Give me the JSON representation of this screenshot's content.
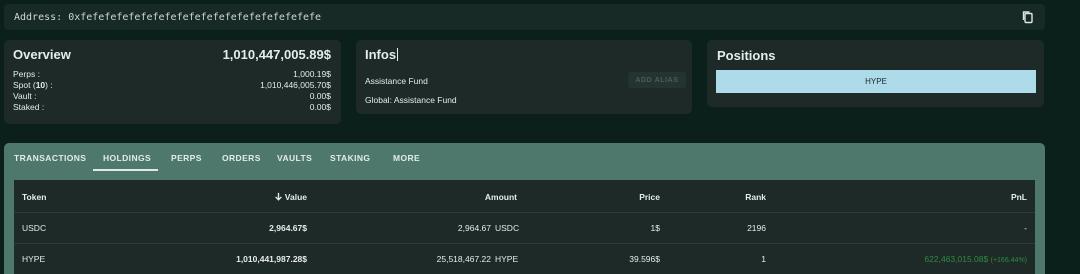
{
  "address": {
    "label": "Address:",
    "value": "0xfefefefefefefefefefefefefefefefefefefefe",
    "copy_icon": "copy-icon"
  },
  "overview": {
    "title": "Overview",
    "total": "1,010,447,005.89$",
    "rows": [
      {
        "label_prefix": "Perps :",
        "count": "",
        "label_suffix": "",
        "value": "1,000.19$"
      },
      {
        "label_prefix": "Spot (",
        "count": "10",
        "label_suffix": ") :",
        "value": "1,010,446,005.70$"
      },
      {
        "label_prefix": "Vault :",
        "count": "",
        "label_suffix": "",
        "value": "0.00$"
      },
      {
        "label_prefix": "Staked :",
        "count": "",
        "label_suffix": "",
        "value": "0.00$"
      }
    ]
  },
  "infos": {
    "title": "Infos",
    "line1": "Assistance Fund",
    "line2": "Global: Assistance Fund",
    "add_alias": "ADD ALIAS"
  },
  "positions": {
    "title": "Positions",
    "items": [
      "HYPE"
    ],
    "bar_color": "#aedbe9"
  },
  "tabs": {
    "items": [
      "TRANSACTIONS",
      "HOLDINGS",
      "PERPS",
      "ORDERS",
      "VAULTS",
      "STAKING",
      "MORE"
    ],
    "active": "HOLDINGS"
  },
  "holdings": {
    "columns": {
      "token": "Token",
      "value": "Value",
      "amount": "Amount",
      "price": "Price",
      "rank": "Rank",
      "pnl": "PnL"
    },
    "sort_icon": "arrow-down-icon",
    "rows": [
      {
        "token": "USDC",
        "value": "2,964.67$",
        "amount": "2,964.67",
        "amount_unit": "USDC",
        "price": "1$",
        "rank": "2196",
        "pnl": "-",
        "pnl_pct": ""
      },
      {
        "token": "HYPE",
        "value": "1,010,441,987.28$",
        "amount": "25,518,467.22",
        "amount_unit": "HYPE",
        "price": "39.596$",
        "rank": "1",
        "pnl": "622,463,015.08$",
        "pnl_pct": "(+166.44%)"
      }
    ]
  },
  "colors": {
    "background": "#0b1f1b",
    "card": "#1e2a27",
    "tabs": "#4f786c",
    "positive": "#2f8a43"
  }
}
